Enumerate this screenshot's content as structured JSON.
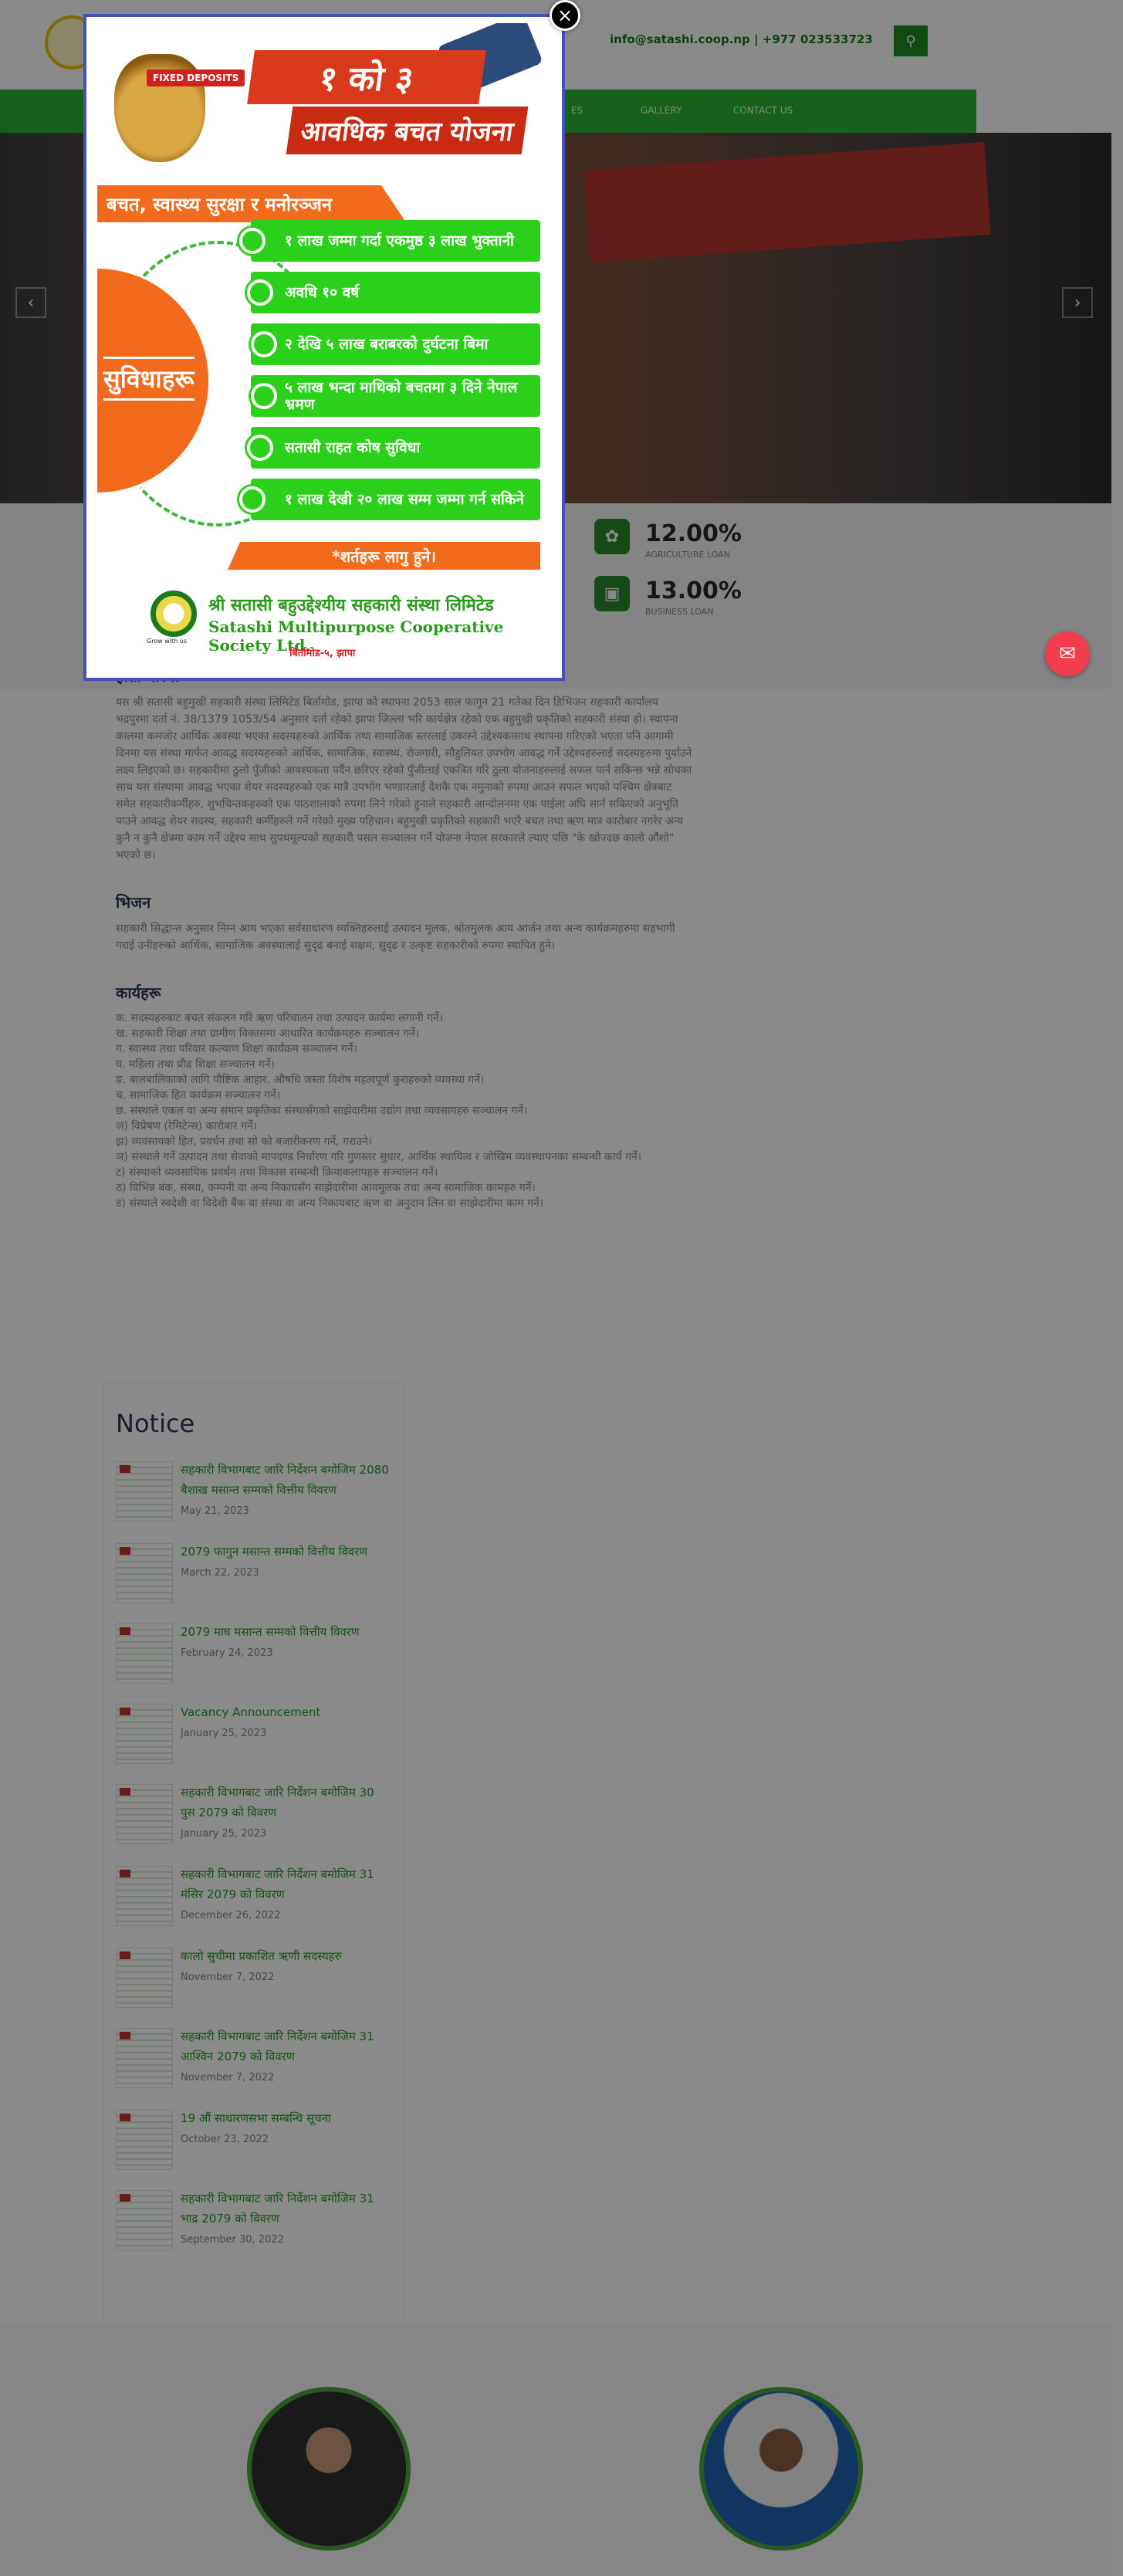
{
  "header": {
    "contact": "info@satashi.coop.np | +977 023533723",
    "nav_items": [
      "ES",
      "GALLERY",
      "CONTACT US"
    ]
  },
  "rates": [
    {
      "value": "12.00%",
      "label": "AGRICULTURE LOAN"
    },
    {
      "value": "13.00%",
      "label": "BUSINESS LOAN"
    }
  ],
  "about": {
    "title": "हाम्रो बारेमा",
    "text": "यस श्री सतासी बहुमुखी सहकारी संस्था लिमिटेड बिर्तामोड, झापा को स्थापना 2053 साल फागुन 21 गतेका दिन डिभिजन सहकारी कार्यालय भद्रपुरमा दर्ता नं. 38/1379 1053/54 अनुसार दर्ता रहेको झापा जिल्ला भरि कार्यक्षेत्र रहेको एक बहुमुखी प्रकृतिको सहकारी संस्था हो। स्थापना कालमा कमजोर आर्थिक अवस्था भएका सदस्यहरुको आर्थिक तथा सामाजिक स्तरलाई उकास्ने उद्देश्यकासाथ स्थापना गरिएको भएता पनि आगामी दिनमा यस संस्था मार्फत आवद्ध सदस्यहरुको आर्थिक, सामाजिक, स्वास्थ्य, रोजगारी, सौहुलियत उपभोग आवद्ध गर्ने उद्देश्यहरुलाई सदस्यहरुमा पुर्याउने लक्ष्य लिइएको छ। सहकारीमा ठुलो पुँजीको आवश्यकता पर्दैन छरिएर रहेको पुँजीलाई एकत्रित गरि ठुला योजनाहरुलाई सफल पार्न सकिन्छ भन्ने सोचका साथ यस संस्थामा आवद्ध भएका शेयर सदस्यहरुको एक मात्रै उपभोग भण्डारलाई देशकै एक नमुनाको रुपमा आउन सफल भएको पश्चिम क्षेत्रबाट समेत सहकारीकर्मीहरु, शुभचिन्तकहरुको एक पाठशालाको रुपमा लिने गरेको हुनाले सहकारी आन्दोलनमा एक पाईला अघि सार्न सकिएको अनुभूति पाउने आवद्ध शेयर सदस्य, सहकारी कर्मीहरुले गर्ने गरेको मुख्य पहिचान। बहुमुखी प्रकृतिको सहकारी भएरै बचत तथा ऋण मात्र कारोबार नगरेर अन्य कुनै न कुनै क्षेत्रमा काम गर्ने उद्देश्य साथ सुपथमूल्यको सहकारी पसल सञ्चालन गर्ने योजना नेपाल सरकारले ल्याए पछि \"के खोज्दछ कालो औंशो\" भएको छ।"
  },
  "vision": {
    "title": "भिजन",
    "text": "सहकारी सिद्धान्त अनुसार निम्न आय भएका सर्वसाधारण व्यक्तिहरुलाई उत्पादन मुलक, श्रोतमुलक आय आर्जन तथा अन्य कार्यक्रमहरुमा सहभागी गराई उनीहरुको आर्थिक, सामाजिक अवस्थालाई सुदृढ बनाई सक्षम, सुदृढ र उत्कृष्ट सहकारीको रुपमा स्थापित हुने।"
  },
  "activities": {
    "title": "कार्यहरू",
    "items": [
      "क. सदस्यहरुबाट बचत संकलन गरि ऋण परिचालन तथा उत्पादन कार्यमा लगानी गर्ने।",
      "ख. सहकारी शिक्षा तथा ग्रामीण विकासमा आधारित कार्यक्रमहरु सञ्चालन गर्ने।",
      "ग. स्वास्थ्य तथा परिवार कल्याण शिक्षा कार्यक्रम सञ्चालन गर्ने।",
      "घ. महिला तथा प्रौढ शिक्षा सञ्चालन गर्ने।",
      "ङ. बालबालिकाको लागि पौष्टिक आहार, औषधि जस्ता विशेष महत्वपूर्ण कुराहरुको व्यवस्था गर्ने।",
      "च. सामाजिक हित कार्यक्रम सञ्चालन गर्ने।",
      "छ. संस्थाले एकल वा अन्य समान प्रकृतिका संस्थासँगको साझेदारीमा उद्योग तथा व्यवसायहरु सञ्चालन गर्ने।",
      "ज) विप्रेषण (रेमिटेन्स) कारोबार गर्ने।",
      "झ) व्यवसायको हित, प्रवर्धन तथा सो को बजारीकरण गर्ने, गराउने।",
      "ञ) संस्थाले गर्ने उत्पादन तथा सेवाको मापदण्ड निर्धारण गरि गुणस्तर सुधार, आर्थिक स्थायित्व र जोखिम व्यवस्थापनका सम्बन्धी कार्य गर्ने।",
      "ट) संस्थाको व्यवसायिक प्रवर्धन तथा विकास सम्बन्धी क्रियाकलापहरु सञ्चालन गर्ने।",
      "ठ) विभिन्न बंक, संस्था, कम्पनी वा अन्य निकायसँग साझेदारीमा आयमुलक तथा अन्य सामाजिक कामहरु गर्ने।",
      "ड) संस्थाले स्वदेशी वा विदेशी बैंक वा संस्था वा अन्य निकायबाट ऋण वा अनुदान लिन वा साझेदारीमा काम गर्ने।"
    ]
  },
  "notice": {
    "title": "Notice",
    "items": [
      {
        "title": "सहकारी विभागबाट जारि निर्देशन बमोजिम 2080 बैशाख मसान्त सम्मको वित्तीय विवरण",
        "date": "May 21, 2023"
      },
      {
        "title": "2079 फागुन मसान्त सम्मको वित्तीय विवरण",
        "date": "March 22, 2023"
      },
      {
        "title": "2079 माघ मसान्त सम्मको वित्तीय विवरण",
        "date": "February 24, 2023"
      },
      {
        "title": "Vacancy Announcement",
        "date": "January 25, 2023"
      },
      {
        "title": "सहकारी विभागबाट जारि निर्देशन बमोजिम 30 पुस 2079 को विवरण",
        "date": "January 25, 2023"
      },
      {
        "title": "सहकारी विभागबाट जारि निर्देशन बमोजिम 31 मंसिर 2079 को विवरण",
        "date": "December 26, 2022"
      },
      {
        "title": "कालो सुचीमा प्रकाशित ऋणी सदस्यहरु",
        "date": "November 7, 2022"
      },
      {
        "title": "सहकारी विभागबाट जारि निर्देशन बमोजिम 31 आश्विन 2079 को विवरण",
        "date": "November 7, 2022"
      },
      {
        "title": "19 औं साधारणसभा सम्बन्धि सूचना",
        "date": "October 23, 2022"
      },
      {
        "title": "सहकारी विभागबाट जारि निर्देशन बमोजिम 31 भाद्र 2079 को विवरण",
        "date": "September 30, 2022"
      }
    ]
  },
  "popup": {
    "close": "×",
    "fd_label": "FIXED DEPOSITS",
    "headline1": "१ को ३",
    "headline2": "आवधिक बचत योजना",
    "subhead": "बचत, स्वास्थ्य सुरक्षा र मनोरञ्जन",
    "side_label": "सुविधाहरू",
    "benefits": [
      "१ लाख जम्मा गर्दा एकमुष्ठ ३ लाख भुक्तानी",
      "अवधि १० वर्ष",
      "२ देखि ५ लाख बराबरको दुर्घटना बिमा",
      "५ लाख भन्दा माथिको बचतमा ३ दिने नेपाल भ्रमण",
      "सतासी राहत कोष सुविधा",
      "१ लाख देखी २० लाख सम्म जम्मा गर्न सकिने"
    ],
    "terms": "*शर्तहरू लागु हुने।",
    "seal_text": "Grow with us",
    "coop_np": "श्री सतासी बहुउद्देश्यीय सहकारी संस्था लिमिटेड",
    "coop_en": "Satashi Multipurpose Cooperative Society Ltd.",
    "coop_addr": "बिर्तामोड-५, झापा"
  },
  "colors": {
    "accent": "#2ab530",
    "brand_green": "#1e8b1e",
    "popup_border": "#4452b8",
    "orange": "#f26b1c"
  }
}
